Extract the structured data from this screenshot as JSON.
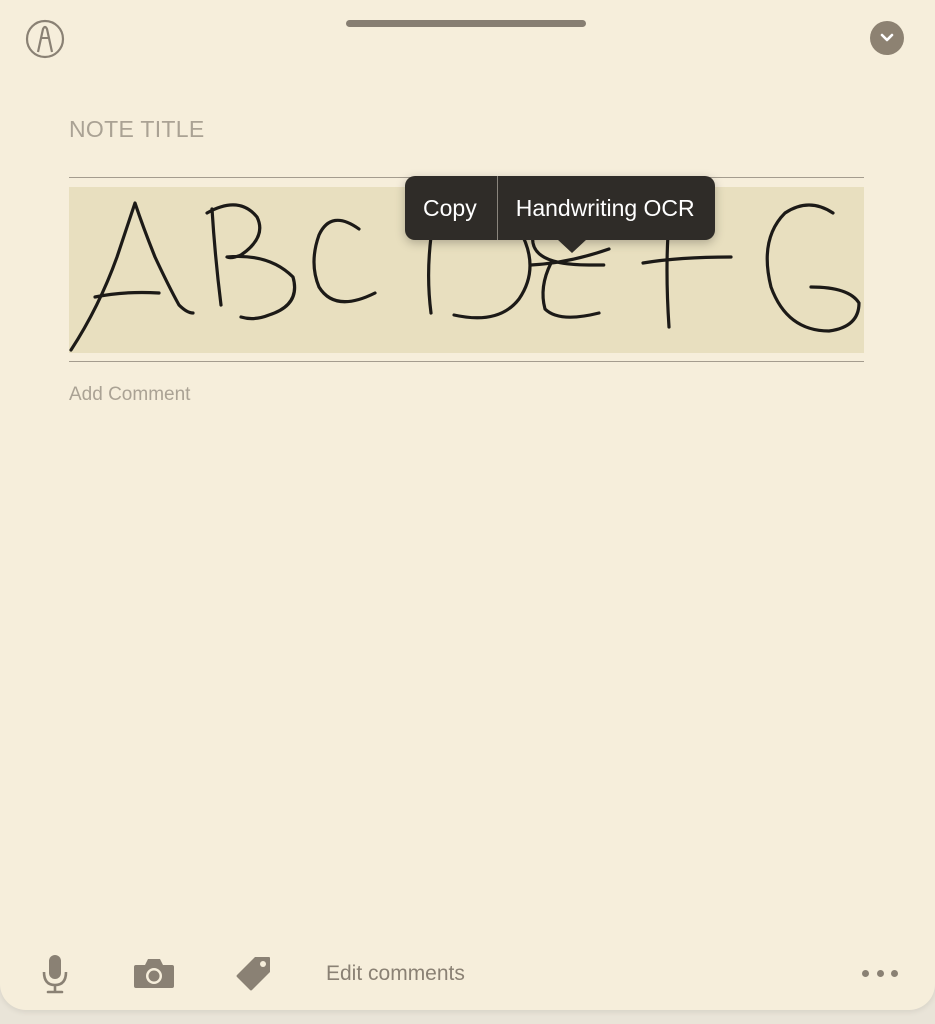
{
  "header": {
    "pencil_icon": "pencil-circle-icon",
    "collapse_icon": "chevron-down-icon"
  },
  "note": {
    "title_placeholder": "NOTE TITLE",
    "comment_placeholder": "Add Comment",
    "handwriting": "ABCDEFG"
  },
  "context_menu": {
    "copy_label": "Copy",
    "ocr_label": "Handwriting OCR"
  },
  "toolbar": {
    "mic_icon": "microphone-icon",
    "camera_icon": "camera-icon",
    "tag_icon": "tag-icon",
    "edit_comments_label": "Edit comments",
    "more_icon": "ellipsis-icon"
  },
  "colors": {
    "background": "#f6eedb",
    "ink_highlight": "#e8dfbf",
    "menu_bg": "#2f2c28",
    "icon": "#8a8174"
  }
}
